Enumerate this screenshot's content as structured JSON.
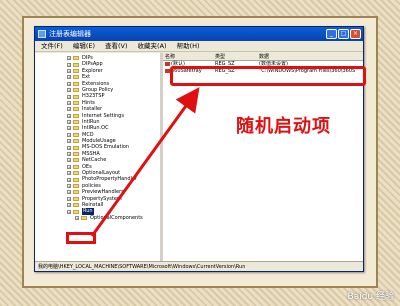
{
  "window": {
    "title": "注册表编辑器",
    "min": "_",
    "max": "□",
    "close": "×"
  },
  "menu": [
    "文件(F)",
    "编辑(E)",
    "查看(V)",
    "收藏夹(A)",
    "帮助(H)"
  ],
  "tree": [
    {
      "label": "DIPs"
    },
    {
      "label": "DIPsApp"
    },
    {
      "label": "Explorer"
    },
    {
      "label": "Ext"
    },
    {
      "label": "Extensions"
    },
    {
      "label": "Group Policy"
    },
    {
      "label": "H323TSP"
    },
    {
      "label": "Hints"
    },
    {
      "label": "Installer"
    },
    {
      "label": "Internet Settings"
    },
    {
      "label": "IntlRun"
    },
    {
      "label": "IntlRun.OC"
    },
    {
      "label": "MCD"
    },
    {
      "label": "ModuleUsage"
    },
    {
      "label": "MS-DOS Emulation"
    },
    {
      "label": "MSSHA"
    },
    {
      "label": "NetCache"
    },
    {
      "label": "OEs"
    },
    {
      "label": "OptionalLayout"
    },
    {
      "label": "PhotoPropertyHandler"
    },
    {
      "label": "policies"
    },
    {
      "label": "PreviewHandlers"
    },
    {
      "label": "PropertySystem"
    },
    {
      "label": "Reinstall"
    },
    {
      "label": "Run",
      "selected": true
    },
    {
      "label": "OptionalComponents",
      "sub": true
    }
  ],
  "list": {
    "headers": [
      "名称",
      "类型",
      "数据"
    ],
    "rows": [
      {
        "name": "(默认)",
        "type": "REG_SZ",
        "data": "(数值未设置)"
      },
      {
        "name": "360Safetray",
        "type": "REG_SZ",
        "data": "\"C:\\WINDOWS\\Program Files\\360\\360S"
      }
    ]
  },
  "status": "我的电脑\\HKEY_LOCAL_MACHINE\\SOFTWARE\\Microsoft\\Windows\\CurrentVersion\\Run",
  "annotation": {
    "callout": "随机启动项",
    "color": "#e01010"
  },
  "watermark": "Baidu 经验"
}
